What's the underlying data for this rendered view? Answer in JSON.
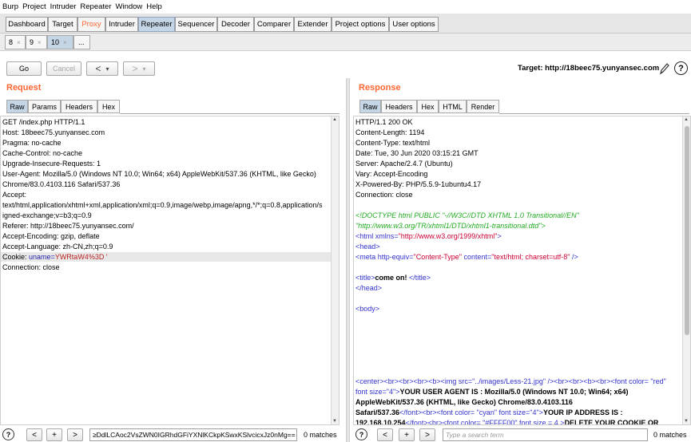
{
  "menu": [
    "Burp",
    "Project",
    "Intruder",
    "Repeater",
    "Window",
    "Help"
  ],
  "main_tabs": [
    "Dashboard",
    "Target",
    "Proxy",
    "Intruder",
    "Repeater",
    "Sequencer",
    "Decoder",
    "Comparer",
    "Extender",
    "Project options",
    "User options"
  ],
  "sub_tabs": [
    {
      "label": "8",
      "close": "×"
    },
    {
      "label": "9",
      "close": "×"
    },
    {
      "label": "10",
      "close": "×"
    },
    {
      "label": "...",
      "close": ""
    }
  ],
  "toolbar": {
    "go": "Go",
    "cancel": "Cancel",
    "back": "<",
    "forward": ">",
    "dropdown": "▾",
    "target": "Target: http://18beec75.yunyansec.com",
    "help": "?"
  },
  "request": {
    "title": "Request",
    "tabs": [
      "Raw",
      "Params",
      "Headers",
      "Hex"
    ],
    "lines": [
      "GET /index.php HTTP/1.1",
      "Host: 18beec75.yunyansec.com",
      "Pragma: no-cache",
      "Cache-Control: no-cache",
      "Upgrade-Insecure-Requests: 1",
      "User-Agent: Mozilla/5.0 (Windows NT 10.0; Win64; x64) AppleWebKit/537.36 (KHTML, like Gecko)",
      "Chrome/83.0.4103.116 Safari/537.36",
      "Accept:",
      "text/html,application/xhtml+xml,application/xml;q=0.9,image/webp,image/apng,*/*;q=0.8,application/s",
      "igned-exchange;v=b3;q=0.9",
      "Referer: http://18beec75.yunyansec.com/",
      "Accept-Encoding: gzip, deflate",
      "Accept-Language: zh-CN,zh;q=0.9"
    ],
    "cookie_prefix": "Cookie: ",
    "cookie_key": "uname=",
    "cookie_value": "YWRtaW4%3D '",
    "last_line": "Connection: close"
  },
  "response": {
    "title": "Response",
    "tabs": [
      "Raw",
      "Headers",
      "Hex",
      "HTML",
      "Render"
    ],
    "headers": [
      "HTTP/1.1 200 OK",
      "Content-Length: 1194",
      "Content-Type: text/html",
      "Date: Tue, 30 Jun 2020 03:15:21 GMT",
      "Server: Apache/2.4.7 (Ubuntu)",
      "Vary: Accept-Encoding",
      "X-Powered-By: PHP/5.5.9-1ubuntu4.17",
      "Connection: close"
    ],
    "doctype1": "<!DOCTYPE html PUBLIC \"-//W3C//DTD XHTML 1.0 Transitional//EN\"",
    "doctype2": "\"http://www.w3.org/TR/xhtml1/DTD/xhtml1-transitional.dtd\">",
    "html_open": "<html",
    "xmlns_attr": " xmlns=",
    "xmlns_val": "\"http://www.w3.org/1999/xhtml\"",
    "html_close_bracket": ">",
    "head_open": "<head>",
    "meta_open": "<meta",
    "meta_attr1": " http-equiv=",
    "meta_val1": "\"Content-Type\"",
    "meta_attr2": " content=",
    "meta_val2": "\"text/html; charset=utf-8\"",
    "meta_close": " />",
    "title_open": "<title>",
    "title_text": "come on! ",
    "title_close": "</title>",
    "head_close": "</head>",
    "body_open": "<body>",
    "center_line1": "<center><br><br><br><b><img src=\"../images/Less-21.jpg\" /><br><br><b><br><font color= \"red\"",
    "center_line2a": "font size=\"4\">",
    "center_line2b": "YOUR USER AGENT IS : Mozilla/5.0 (Windows NT 10.0; Win64; x64)",
    "center_line3": "AppleWebKit/537.36 (KHTML, like Gecko) Chrome/83.0.4103.116",
    "center_line4a": "Safari/537.36",
    "center_line4b": "</font><br><font color= \"cyan\" font size=\"4\">",
    "center_line4c": "YOUR IP ADDRESS IS :",
    "center_line5a": "192.168.10.254",
    "center_line5b": "</font><br><font color= \"#FFFF00\" font size = 4 >",
    "center_line5c": "DELETE YOUR COOKIE OR"
  },
  "search_left": {
    "help": "?",
    "prev": "<",
    "add": "+",
    "next": ">",
    "value": "≥DdlLCAoc2VsZWN0IGRhdGFiYXNlKCkpKSwxKSlvcicxJz0nMg==",
    "matches": "0 matches"
  },
  "search_right": {
    "help": "?",
    "prev": "<",
    "add": "+",
    "next": ">",
    "placeholder": "Type a search term",
    "matches": "0 matches"
  }
}
